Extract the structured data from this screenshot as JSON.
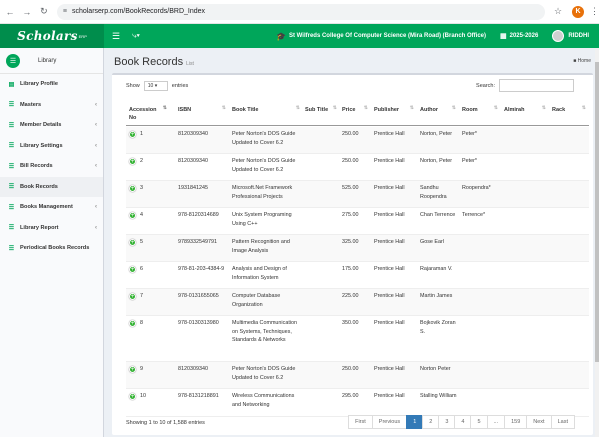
{
  "browser": {
    "url": "scholarserp.com/BookRecords/BRD_Index",
    "profile_initial": "K"
  },
  "app": {
    "logo": "Scholars",
    "logo_sup": "ERP",
    "college": "St Wilfreds College Of Computer Science (Mira Road) (Branch Office)",
    "year": "2025-2026",
    "user": "RIDDHI",
    "accent": "#00a65a"
  },
  "sidebar": {
    "header": "Library",
    "items": [
      {
        "label": "Library Profile",
        "icon": "bank-icon",
        "chevron": false
      },
      {
        "label": "Masters",
        "icon": "list-icon",
        "chevron": true
      },
      {
        "label": "Member Details",
        "icon": "list-icon",
        "chevron": true
      },
      {
        "label": "Library Settings",
        "icon": "list-icon",
        "chevron": true
      },
      {
        "label": "Bill Records",
        "icon": "list-icon",
        "chevron": true
      },
      {
        "label": "Book Records",
        "icon": "list-icon",
        "chevron": false,
        "active": true
      },
      {
        "label": "Books Management",
        "icon": "list-icon",
        "chevron": true
      },
      {
        "label": "Library Report",
        "icon": "list-icon",
        "chevron": true
      },
      {
        "label": "Periodical Books Records",
        "icon": "list-icon",
        "chevron": false
      }
    ]
  },
  "page": {
    "title": "Book Records",
    "subtitle": "List",
    "breadcrumb": "Home"
  },
  "table_controls": {
    "show_label": "Show",
    "page_size": "10",
    "entries_label": "entries",
    "search_label": "Search:"
  },
  "columns": [
    "Accession No",
    "ISBN",
    "Book Title",
    "Sub Title",
    "Price",
    "Publisher",
    "Author",
    "Room",
    "Almirah",
    "Rack"
  ],
  "rows": [
    {
      "acc": "1",
      "isbn": "8120309340",
      "title": "Peter Norton's DOS Guide Updated to Cover 6.2",
      "sub": "",
      "price": "250.00",
      "publisher": "Prentice Hall",
      "author": "Norton, Peter",
      "room": "Peter*",
      "almirah": "",
      "rack": ""
    },
    {
      "acc": "2",
      "isbn": "8120309340",
      "title": "Peter Norton's DOS Guide Updated to Cover 6.2",
      "sub": "",
      "price": "250.00",
      "publisher": "Prentice Hall",
      "author": "Norton, Peter",
      "room": "Peter*",
      "almirah": "",
      "rack": ""
    },
    {
      "acc": "3",
      "isbn": "1931841245",
      "title": "Microsoft.Net Framework Professional Projects",
      "sub": "",
      "price": "525.00",
      "publisher": "Prentice Hall",
      "author": "Sandhu Roopendra",
      "room": "Roopendra*",
      "almirah": "",
      "rack": ""
    },
    {
      "acc": "4",
      "isbn": "978-8120314689",
      "title": "Unix System Programing Using C++",
      "sub": "",
      "price": "275.00",
      "publisher": "Prentice Hall",
      "author": "Chan Terrence",
      "room": "Terrence*",
      "almirah": "",
      "rack": ""
    },
    {
      "acc": "5",
      "isbn": "9789332549791",
      "title": "Pattern Recognition and Image Analysis",
      "sub": "",
      "price": "325.00",
      "publisher": "Prentice Hall",
      "author": "Gose Earl",
      "room": "",
      "almirah": "",
      "rack": ""
    },
    {
      "acc": "6",
      "isbn": "978-81-203-4384-9",
      "title": "Analysis and Design of Information System",
      "sub": "",
      "price": "175.00",
      "publisher": "Prentice Hall",
      "author": "Rajaraman V.",
      "room": "",
      "almirah": "",
      "rack": ""
    },
    {
      "acc": "7",
      "isbn": "978-0131655065",
      "title": "Computer Database Organization",
      "sub": "",
      "price": "225.00",
      "publisher": "Prentice Hall",
      "author": "Martin James",
      "room": "",
      "almirah": "",
      "rack": ""
    },
    {
      "acc": "8",
      "isbn": "978-0130313980",
      "title": "Multimedia Communication on Systems, Techniques, Standards & Networks",
      "sub": "",
      "price": "350.00",
      "publisher": "Prentice Hall",
      "author": "Bojkovik Zoran S.",
      "room": "",
      "almirah": "",
      "rack": ""
    },
    {
      "acc": "9",
      "isbn": "8120309340",
      "title": "Peter Norton's DOS Guide Updated to Cover 6.2",
      "sub": "",
      "price": "250.00",
      "publisher": "Prentice Hall",
      "author": "Norton Peter",
      "room": "",
      "almirah": "",
      "rack": ""
    },
    {
      "acc": "10",
      "isbn": "978-8131218891",
      "title": "Wireless Communications and Networking",
      "sub": "",
      "price": "295.00",
      "publisher": "Prentice Hall",
      "author": "Stalling William",
      "room": "",
      "almirah": "",
      "rack": ""
    }
  ],
  "footer": {
    "info": "Showing 1 to 10 of 1,588 entries",
    "pages": [
      "First",
      "Previous",
      "1",
      "2",
      "3",
      "4",
      "5",
      "...",
      "159",
      "Next",
      "Last"
    ],
    "active_page": "1"
  }
}
